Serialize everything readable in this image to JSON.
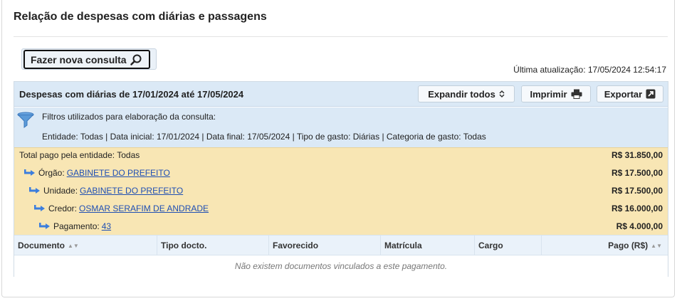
{
  "page": {
    "title": "Relação de despesas com diárias e passagens"
  },
  "search_button": {
    "label": "Fazer nova consulta"
  },
  "last_update": "Última atualização: 17/05/2024 12:54:17",
  "panel": {
    "title": "Despesas com diárias de 17/01/2024 até 17/05/2024",
    "expand_label": "Expandir todos",
    "print_label": "Imprimir",
    "export_label": "Exportar"
  },
  "filters": {
    "heading": "Filtros utilizados para elaboração da consulta:",
    "summary": "Entidade: Todas | Data inicial: 17/01/2024 | Data final: 17/05/2024 | Tipo de gasto: Diárias | Categoria de gasto: Todas"
  },
  "tree": {
    "total_label": "Total pago pela entidade: Todas",
    "total_value": "R$ 31.850,00",
    "orgao_label": "Órgão:",
    "orgao_link": "GABINETE DO PREFEITO",
    "orgao_value": "R$ 17.500,00",
    "unidade_label": "Unidade:",
    "unidade_link": "GABINETE DO PREFEITO",
    "unidade_value": "R$ 17.500,00",
    "credor_label": "Credor:",
    "credor_link": "OSMAR SERAFIM DE ANDRADE",
    "credor_value": "R$ 16.000,00",
    "pagamento_label": "Pagamento:",
    "pagamento_link": "43",
    "pagamento_value": "R$ 4.000,00"
  },
  "table": {
    "columns": [
      "Documento",
      "Tipo docto.",
      "Favorecido",
      "Matrícula",
      "Cargo",
      "Pago (R$)"
    ],
    "empty_message": "Não existem documentos vinculados a este pagamento."
  },
  "colors": {
    "header_bg": "#dbe9f6",
    "tree_bg": "#f8e6b4",
    "link": "#1f4fb3",
    "arrow": "#3b7ddd"
  }
}
